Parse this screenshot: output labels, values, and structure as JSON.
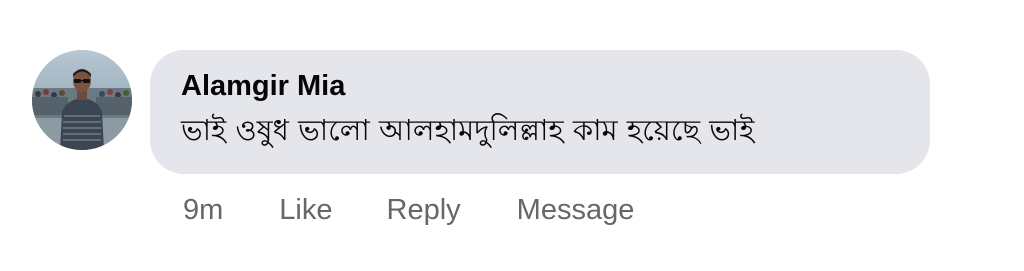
{
  "comment": {
    "author": "Alamgir Mia",
    "text": "ভাই ওষুধ ভালো আলহামদুলিল্লাহ কাম হয়েছে ভাই",
    "avatar_icon": "profile-photo-icon",
    "actions": {
      "time": "9m",
      "like": "Like",
      "reply": "Reply",
      "message": "Message"
    }
  },
  "colors": {
    "bubble": "#e4e6eb",
    "author": "#050505",
    "text": "#050505",
    "actions": "#65676b"
  }
}
